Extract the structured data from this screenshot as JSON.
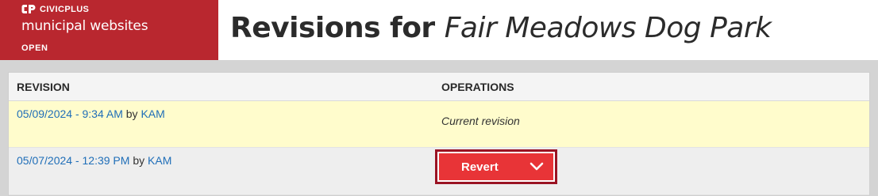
{
  "brand": {
    "name": "CIVICPLUS",
    "product": "municipal websites",
    "status": "OPEN",
    "color": "#b9272f"
  },
  "page": {
    "title_prefix": "Revisions for ",
    "title_name": "Fair Meadows Dog Park"
  },
  "table": {
    "columns": [
      "REVISION",
      "OPERATIONS"
    ],
    "rows": [
      {
        "date": "05/09/2024 - 9:34 AM",
        "by": " by ",
        "author": "KAM",
        "operation": "Current revision"
      },
      {
        "date": "05/07/2024 - 12:39 PM",
        "by": " by ",
        "author": "KAM",
        "operation_button": "Revert",
        "operation_icon": "chevron-down-icon"
      }
    ]
  },
  "colors": {
    "link": "#1f6eb8",
    "current_row_bg": "#fffccc",
    "button_bg": "#e83437",
    "button_focus": "#9a1323"
  }
}
